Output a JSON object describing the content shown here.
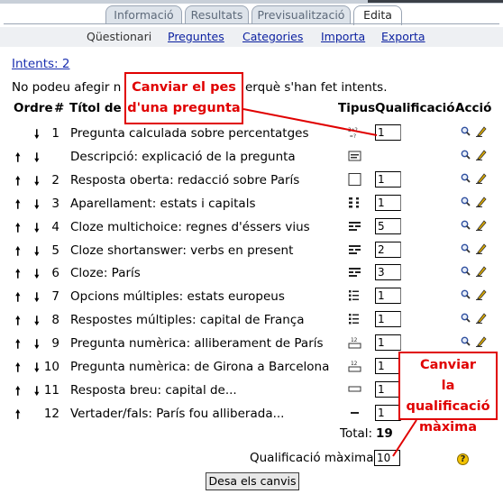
{
  "tabs": [
    {
      "label": "Informació",
      "active": false
    },
    {
      "label": "Resultats",
      "active": false
    },
    {
      "label": "Previsualització",
      "active": false
    },
    {
      "label": "Edita",
      "active": true
    }
  ],
  "subtabs": {
    "current": "Qüestionari",
    "links": [
      "Preguntes",
      "Categories",
      "Importa",
      "Exporta"
    ]
  },
  "intents_link": "Intents: 2",
  "notice_left": "No podeu afegir n",
  "notice_right": "erquè s'han fet intents.",
  "headers": {
    "order": "Ordre",
    "number": "#",
    "title": "Títol de la",
    "type": "Tipus",
    "grade": "Qualificació",
    "action": "Acció"
  },
  "questions": [
    {
      "up": false,
      "down": true,
      "num": "1",
      "title": "Pregunta calculada sobre percentatges",
      "type_icon": "calculated-icon",
      "grade": "1"
    },
    {
      "up": true,
      "down": true,
      "num": "",
      "title": "Descripció: explicació de la pregunta",
      "type_icon": "description-icon",
      "grade": ""
    },
    {
      "up": true,
      "down": true,
      "num": "2",
      "title": "Resposta oberta: redacció sobre París",
      "type_icon": "essay-icon",
      "grade": "1"
    },
    {
      "up": true,
      "down": true,
      "num": "3",
      "title": "Aparellament: estats i capitals",
      "type_icon": "matching-icon",
      "grade": "1"
    },
    {
      "up": true,
      "down": true,
      "num": "4",
      "title": "Cloze multichoice: regnes d'éssers vius",
      "type_icon": "cloze-icon",
      "grade": "5"
    },
    {
      "up": true,
      "down": true,
      "num": "5",
      "title": "Cloze shortanswer: verbs en present",
      "type_icon": "cloze-icon",
      "grade": "2"
    },
    {
      "up": true,
      "down": true,
      "num": "6",
      "title": "Cloze: París",
      "type_icon": "cloze-icon",
      "grade": "3"
    },
    {
      "up": true,
      "down": true,
      "num": "7",
      "title": "Opcions múltiples: estats europeus",
      "type_icon": "multichoice-icon",
      "grade": "1"
    },
    {
      "up": true,
      "down": true,
      "num": "8",
      "title": "Respostes múltiples: capital de França",
      "type_icon": "multichoice-icon",
      "grade": "1"
    },
    {
      "up": true,
      "down": true,
      "num": "9",
      "title": "Pregunta numèrica: alliberament de París",
      "type_icon": "numerical-icon",
      "grade": "1"
    },
    {
      "up": true,
      "down": true,
      "num": "10",
      "title": "Pregunta numèrica: de Girona a Barcelona",
      "type_icon": "numerical-icon",
      "grade": "1"
    },
    {
      "up": true,
      "down": true,
      "num": "11",
      "title": "Resposta breu: capital de...",
      "type_icon": "shortanswer-icon",
      "grade": "1"
    },
    {
      "up": true,
      "down": false,
      "num": "12",
      "title": "Vertader/fals: París fou alliberada...",
      "type_icon": "truefalse-icon",
      "grade": "1"
    }
  ],
  "total_label": "Total:",
  "total_value": "19",
  "max_grade_label": "Qualificació màxima:",
  "max_grade_value": "10",
  "help_label": "?",
  "save_button": "Desa els canvis",
  "callouts": {
    "question_weight": [
      "Canviar el pes",
      "d'una pregunta"
    ],
    "max_grade": [
      "Canviar",
      "la qualificació",
      "màxima"
    ]
  },
  "colors": {
    "callout": "#e00000",
    "link": "#0a1fa0"
  }
}
